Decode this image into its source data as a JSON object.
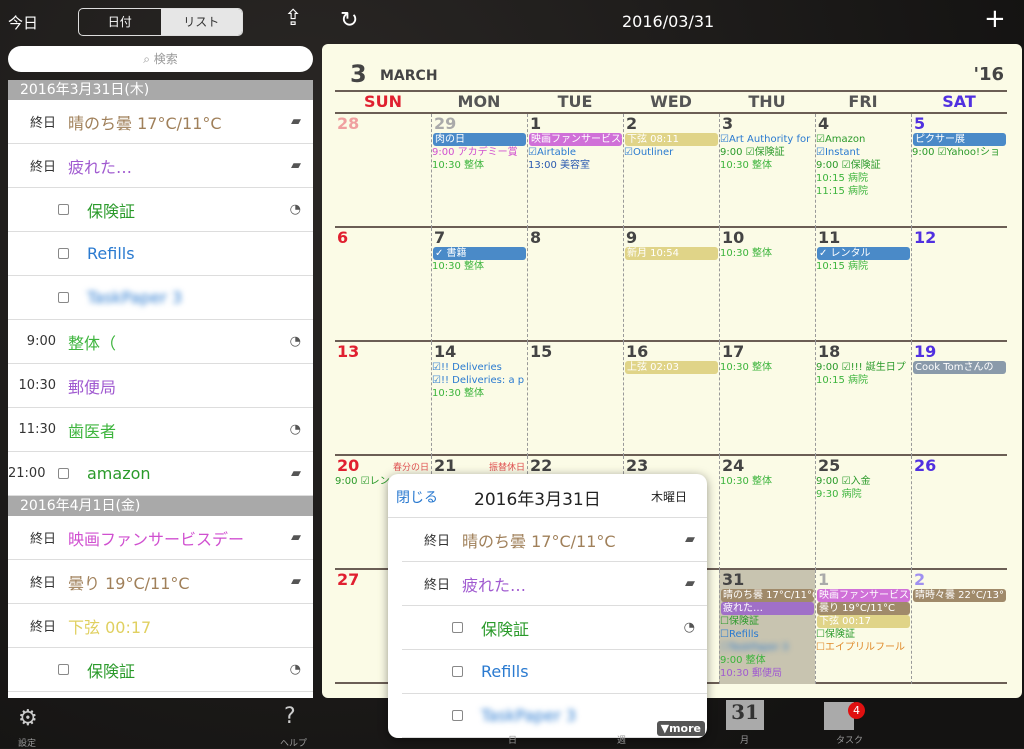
{
  "topbar": {
    "today": "今日",
    "seg_date": "日付",
    "seg_list": "リスト",
    "title": "2016/03/31",
    "share": "⇪",
    "refresh": "↻",
    "add": "+"
  },
  "search": {
    "placeholder": "検索",
    "icon": "search-icon"
  },
  "list": [
    {
      "header": "2016年3月31日(木)",
      "rows": [
        {
          "time": "終日",
          "text": "晴のち曇 17°C/11°C",
          "color": "#a0805a",
          "icon": "note-icon"
        },
        {
          "time": "終日",
          "text": "疲れた…",
          "color": "#a05ad0",
          "icon": "note-icon"
        },
        {
          "check": true,
          "text": "保険証",
          "color": "#2a9a2a",
          "icon": "clock-icon"
        },
        {
          "check": true,
          "text": "Refills",
          "color": "#2a7ad0"
        },
        {
          "check": true,
          "text": "TaskPaper 3",
          "color": "#2a7ad0",
          "blur": true
        },
        {
          "time": "9:00",
          "text": "整体（",
          "color": "#3cb43c",
          "icon": "clock-icon"
        },
        {
          "time": "10:30",
          "text": "郵便局",
          "color": "#a05ad0"
        },
        {
          "time": "11:30",
          "text": "歯医者",
          "color": "#3cb43c",
          "icon": "clock-icon"
        },
        {
          "time": "21:00",
          "check": true,
          "text": "amazon",
          "color": "#2a9a2a",
          "icon": "note-icon"
        }
      ]
    },
    {
      "header": "2016年4月1日(金)",
      "rows": [
        {
          "time": "終日",
          "text": "映画ファンサービスデー",
          "color": "#d050d0",
          "icon": "note-icon"
        },
        {
          "time": "終日",
          "text": "曇り 19°C/11°C",
          "color": "#a0805a",
          "icon": "note-icon"
        },
        {
          "time": "終日",
          "text": "下弦 00:17",
          "color": "#e0d060"
        },
        {
          "check": true,
          "text": "保険証",
          "color": "#2a9a2a",
          "icon": "clock-icon"
        }
      ]
    }
  ],
  "calendar": {
    "month_num": "3",
    "month_name": "MARCH",
    "year": "'16",
    "weekdays": [
      "SUN",
      "MON",
      "TUE",
      "WED",
      "THU",
      "FRI",
      "SAT"
    ],
    "weeks": [
      [
        {
          "d": "28",
          "dim": true,
          "ev": []
        },
        {
          "d": "29",
          "dim": true,
          "ev": [
            {
              "t": "肉の日",
              "bar": "#4a8ac8"
            },
            {
              "t": "9:00 アカデミー賞",
              "c": "#d050d0"
            },
            {
              "t": "10:30 整体",
              "c": "#3cb43c"
            }
          ]
        },
        {
          "d": "1",
          "ev": [
            {
              "t": "映画ファンサービスデー",
              "bar": "#d070d8"
            },
            {
              "t": "☑Airtable",
              "c": "#2a7ad0"
            },
            {
              "t": "13:00 美容室",
              "c": "#2a5ab0"
            }
          ]
        },
        {
          "d": "2",
          "ev": [
            {
              "t": "下弦 08:11",
              "bar": "#e0d488"
            },
            {
              "t": "☑Outliner",
              "c": "#2a7ad0"
            }
          ]
        },
        {
          "d": "3",
          "ev": [
            {
              "t": "☑Art Authority for",
              "c": "#2a7ad0"
            },
            {
              "t": "9:00 ☑保険証",
              "c": "#2a9a2a"
            },
            {
              "t": "10:30 整体",
              "c": "#3cb43c"
            }
          ]
        },
        {
          "d": "4",
          "ev": [
            {
              "t": "☑Amazon",
              "c": "#2a9a2a"
            },
            {
              "t": "☑Instant",
              "c": "#2a7ad0"
            },
            {
              "t": "9:00 ☑保険証",
              "c": "#2a9a2a"
            },
            {
              "t": "10:15 病院",
              "c": "#3cb43c"
            },
            {
              "t": "11:15 病院",
              "c": "#3cb43c"
            }
          ]
        },
        {
          "d": "5",
          "ev": [
            {
              "t": "ピクサー展",
              "bar": "#4a8ac8"
            },
            {
              "t": "9:00 ☑Yahoo!ショ",
              "c": "#2a9a2a"
            }
          ]
        }
      ],
      [
        {
          "d": "6",
          "ev": []
        },
        {
          "d": "7",
          "ev": [
            {
              "t": "✓ 書籍",
              "bar": "#4a8ac8"
            },
            {
              "t": "10:30 整体",
              "c": "#3cb43c"
            }
          ]
        },
        {
          "d": "8",
          "ev": []
        },
        {
          "d": "9",
          "ev": [
            {
              "t": "新月 10:54",
              "bar": "#e0d488"
            }
          ]
        },
        {
          "d": "10",
          "ev": [
            {
              "t": "10:30 整体",
              "c": "#3cb43c"
            }
          ]
        },
        {
          "d": "11",
          "ev": [
            {
              "t": "✓ レンタル",
              "bar": "#4a8ac8"
            },
            {
              "t": "10:15 病院",
              "c": "#3cb43c"
            }
          ]
        },
        {
          "d": "12",
          "ev": []
        }
      ],
      [
        {
          "d": "13",
          "ev": []
        },
        {
          "d": "14",
          "ev": [
            {
              "t": "☑!! Deliveries",
              "c": "#2a7ad0"
            },
            {
              "t": "☑!! Deliveries: a p",
              "c": "#2a7ad0"
            },
            {
              "t": "10:30 整体",
              "c": "#3cb43c"
            }
          ]
        },
        {
          "d": "15",
          "ev": []
        },
        {
          "d": "16",
          "ev": [
            {
              "t": "上弦 02:03",
              "bar": "#e0d488"
            }
          ]
        },
        {
          "d": "17",
          "ev": [
            {
              "t": "10:30 整体",
              "c": "#3cb43c"
            }
          ]
        },
        {
          "d": "18",
          "ev": [
            {
              "t": "9:00 ☑!!! 誕生日プ",
              "c": "#2a9a2a"
            },
            {
              "t": "10:15 病院",
              "c": "#3cb43c"
            }
          ]
        },
        {
          "d": "19",
          "ev": [
            {
              "t": "Cook Tomさんの",
              "bar": "#8a9aaa"
            }
          ]
        }
      ],
      [
        {
          "d": "20",
          "hol": "春分の日",
          "ev": [
            {
              "t": "9:00 ☑レン",
              "c": "#2a9a2a"
            }
          ]
        },
        {
          "d": "21",
          "hol": "振替休日",
          "ev": []
        },
        {
          "d": "22",
          "ev": []
        },
        {
          "d": "23",
          "ev": []
        },
        {
          "d": "24",
          "ev": [
            {
              "t": "10:30 整体",
              "c": "#3cb43c"
            }
          ]
        },
        {
          "d": "25",
          "ev": [
            {
              "t": "9:00 ☑入金",
              "c": "#2a9a2a"
            },
            {
              "t": "9:30 病院",
              "c": "#3cb43c"
            }
          ]
        },
        {
          "d": "26",
          "ev": []
        }
      ],
      [
        {
          "d": "27",
          "ev": []
        },
        {
          "d": "28",
          "ev": []
        },
        {
          "d": "29",
          "ev": []
        },
        {
          "d": "30",
          "ev": []
        },
        {
          "d": "31",
          "today": true,
          "ev": [
            {
              "t": "晴のち曇 17°C/11°C",
              "bar": "#a08a6a"
            },
            {
              "t": "疲れた…",
              "bar": "#a070c8"
            },
            {
              "t": "☐保険証",
              "c": "#2a9a2a"
            },
            {
              "t": "☐Refills",
              "c": "#2a7ad0"
            },
            {
              "t": "☐TaskPaper 3",
              "c": "#2a7ad0",
              "blur": true
            },
            {
              "t": "9:00 整体",
              "c": "#3cb43c"
            },
            {
              "t": "10:30 郵便局",
              "c": "#a05ad0"
            }
          ]
        },
        {
          "d": "1",
          "dim": true,
          "ev": [
            {
              "t": "映画ファンサービスデー",
              "bar": "#d070d8"
            },
            {
              "t": "曇り 19°C/11°C",
              "bar": "#a08a6a"
            },
            {
              "t": "下弦 00:17",
              "bar": "#e0d488"
            },
            {
              "t": "☐保険証",
              "c": "#2a9a2a"
            },
            {
              "t": "☐エイプリルフール",
              "c": "#e08a2a"
            }
          ]
        },
        {
          "d": "2",
          "dim": true,
          "ev": [
            {
              "t": "晴時々曇 22°C/13°",
              "bar": "#a08a6a"
            }
          ]
        }
      ]
    ]
  },
  "popover": {
    "close": "閉じる",
    "date": "2016年3月31日",
    "weekday": "木曜日",
    "more": "▼more",
    "rows": [
      {
        "time": "終日",
        "text": "晴のち曇 17°C/11°C",
        "color": "#a0805a",
        "icon": "note-icon"
      },
      {
        "time": "終日",
        "text": "疲れた…",
        "color": "#a05ad0",
        "icon": "note-icon"
      },
      {
        "check": true,
        "text": "保険証",
        "color": "#2a9a2a",
        "icon": "clock-icon"
      },
      {
        "check": true,
        "text": "Refills",
        "color": "#2a7ad0"
      },
      {
        "check": true,
        "text": "TaskPaper 3",
        "color": "#2a7ad0",
        "blur": true
      }
    ]
  },
  "tabs": [
    {
      "label": "日"
    },
    {
      "label": "週"
    },
    {
      "label": "月",
      "icon_text": "31"
    },
    {
      "label": "タスク",
      "badge": "4"
    }
  ],
  "bottom": {
    "settings": "設定",
    "help": "ヘルプ"
  },
  "colors": {
    "sun": "#e02030",
    "sat": "#5030e0"
  }
}
